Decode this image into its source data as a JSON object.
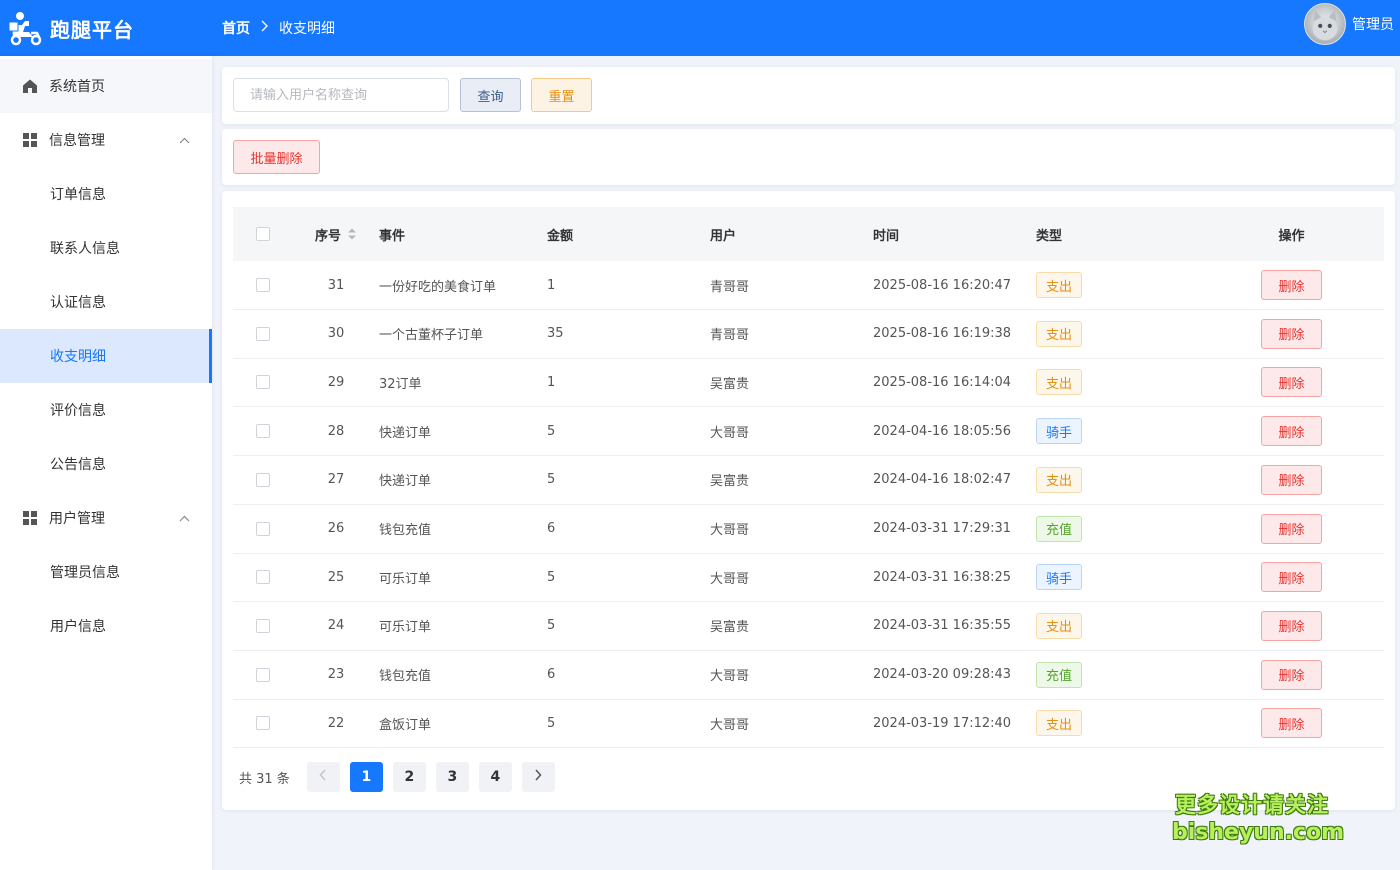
{
  "header": {
    "app_title": "跑腿平台",
    "breadcrumb_home": "首页",
    "breadcrumb_current": "收支明细",
    "username": "管理员"
  },
  "sidebar": {
    "items": [
      {
        "label": "系统首页",
        "icon": "home-icon"
      },
      {
        "label": "信息管理",
        "icon": "grid-icon"
      },
      {
        "label": "订单信息"
      },
      {
        "label": "联系人信息"
      },
      {
        "label": "认证信息"
      },
      {
        "label": "收支明细"
      },
      {
        "label": "评价信息"
      },
      {
        "label": "公告信息"
      },
      {
        "label": "用户管理",
        "icon": "grid-icon"
      },
      {
        "label": "管理员信息"
      },
      {
        "label": "用户信息"
      }
    ]
  },
  "search": {
    "placeholder": "请输入用户名称查询",
    "query_label": "查询",
    "reset_label": "重置"
  },
  "bulk_delete_label": "批量删除",
  "table": {
    "headers": {
      "index": "序号",
      "event": "事件",
      "amount": "金额",
      "user": "用户",
      "time": "时间",
      "type": "类型",
      "op": "操作"
    },
    "delete_label": "删除",
    "rows": [
      {
        "id": "31",
        "event": "一份好吃的美食订单",
        "amount": "1",
        "user": "青哥哥",
        "time": "2025-08-16 16:20:47",
        "type": "支出",
        "type_kind": "out"
      },
      {
        "id": "30",
        "event": "一个古董杯子订单",
        "amount": "35",
        "user": "青哥哥",
        "time": "2025-08-16 16:19:38",
        "type": "支出",
        "type_kind": "out"
      },
      {
        "id": "29",
        "event": "32订单",
        "amount": "1",
        "user": "吴富贵",
        "time": "2025-08-16 16:14:04",
        "type": "支出",
        "type_kind": "out"
      },
      {
        "id": "28",
        "event": "快递订单",
        "amount": "5",
        "user": "大哥哥",
        "time": "2024-04-16 18:05:56",
        "type": "骑手",
        "type_kind": "rider"
      },
      {
        "id": "27",
        "event": "快递订单",
        "amount": "5",
        "user": "吴富贵",
        "time": "2024-04-16 18:02:47",
        "type": "支出",
        "type_kind": "out"
      },
      {
        "id": "26",
        "event": "钱包充值",
        "amount": "6",
        "user": "大哥哥",
        "time": "2024-03-31 17:29:31",
        "type": "充值",
        "type_kind": "charge"
      },
      {
        "id": "25",
        "event": "可乐订单",
        "amount": "5",
        "user": "大哥哥",
        "time": "2024-03-31 16:38:25",
        "type": "骑手",
        "type_kind": "rider"
      },
      {
        "id": "24",
        "event": "可乐订单",
        "amount": "5",
        "user": "吴富贵",
        "time": "2024-03-31 16:35:55",
        "type": "支出",
        "type_kind": "out"
      },
      {
        "id": "23",
        "event": "钱包充值",
        "amount": "6",
        "user": "大哥哥",
        "time": "2024-03-20 09:28:43",
        "type": "充值",
        "type_kind": "charge"
      },
      {
        "id": "22",
        "event": "盒饭订单",
        "amount": "5",
        "user": "大哥哥",
        "time": "2024-03-19 17:12:40",
        "type": "支出",
        "type_kind": "out"
      }
    ]
  },
  "pagination": {
    "total_text": "共 31 条",
    "pages": [
      "1",
      "2",
      "3",
      "4"
    ],
    "current_page": "1"
  },
  "watermark": {
    "line1": "更多设计请关注",
    "line2": "bisheyun.com"
  },
  "colors": {
    "primary": "#1677ff",
    "danger": "#e5322e",
    "warning": "#e6900e",
    "success": "#52a42a"
  }
}
